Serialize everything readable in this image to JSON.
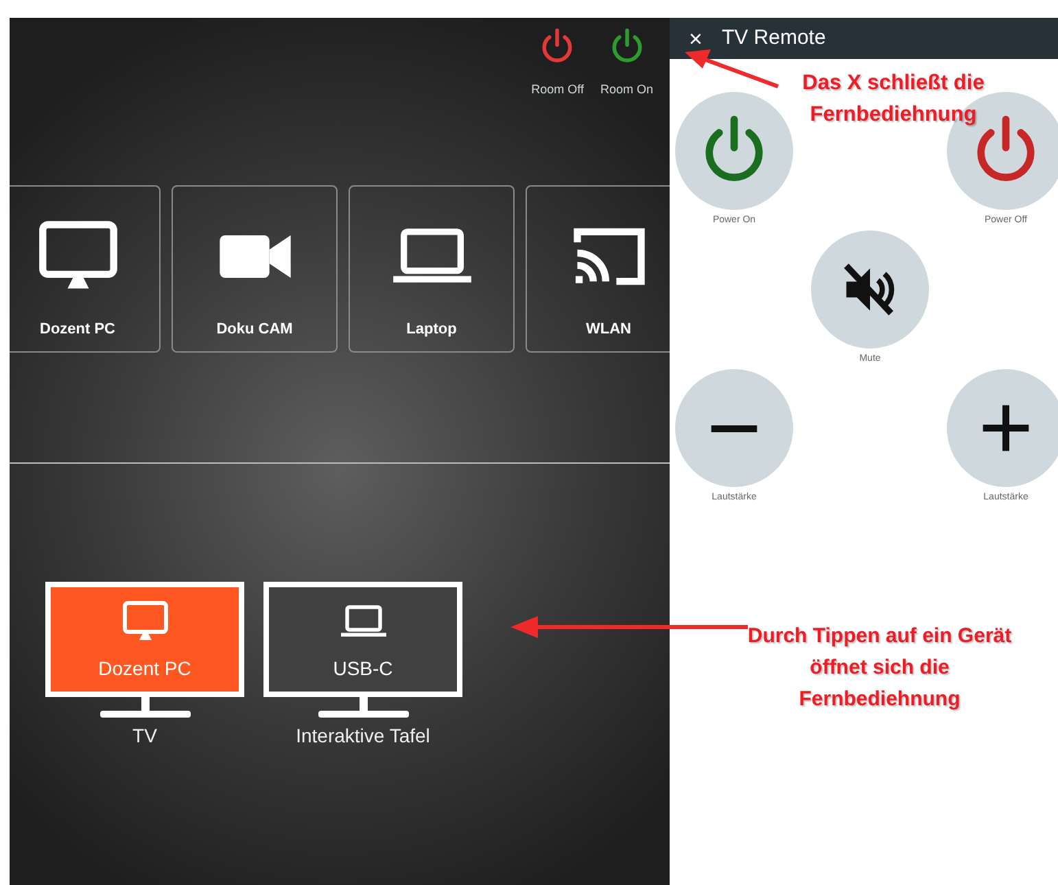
{
  "room_controls": [
    {
      "label": "Room Off",
      "kind": "off"
    },
    {
      "label": "Room On",
      "kind": "on"
    }
  ],
  "sources": [
    {
      "label": "Dozent PC",
      "kind": "monitor"
    },
    {
      "label": "Doku CAM",
      "kind": "camera"
    },
    {
      "label": "Laptop",
      "kind": "laptop"
    },
    {
      "label": "WLAN",
      "kind": "cast"
    }
  ],
  "displays": [
    {
      "name": "TV",
      "source": {
        "label": "Dozent PC",
        "kind": "monitor"
      },
      "selected": true
    },
    {
      "name": "Interaktive Tafel",
      "source": {
        "label": "USB-C",
        "kind": "laptop"
      },
      "selected": false
    }
  ],
  "remote": {
    "title": "TV Remote",
    "close": "×",
    "buttons": [
      {
        "label": "Power On",
        "kind": "power_on"
      },
      {
        "label": "Power Off",
        "kind": "power_off"
      },
      {
        "label": "Mute",
        "kind": "mute"
      },
      {
        "label": "Lautstärke",
        "kind": "volume_down"
      },
      {
        "label": "Lautstärke",
        "kind": "volume_up"
      }
    ]
  },
  "annotations": [
    {
      "text": "Das X schließt die Fernbediehnung",
      "kind": "close_hint"
    },
    {
      "text": "Durch Tippen auf ein Gerät öffnet sich die Fernbediehnung",
      "kind": "device_hint"
    }
  ]
}
